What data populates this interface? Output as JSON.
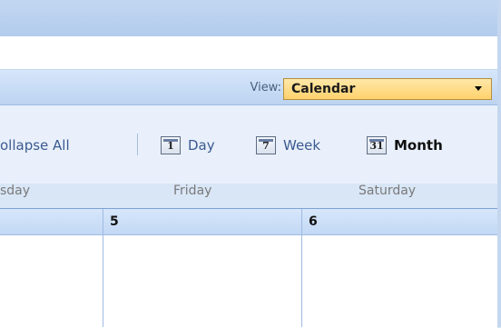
{
  "view_bar": {
    "label": "View:",
    "selected": "Calendar"
  },
  "toolbar": {
    "collapse_label": "ollapse All",
    "day": {
      "icon_text": "1",
      "label": "Day"
    },
    "week": {
      "icon_text": "7",
      "label": "Week"
    },
    "month": {
      "icon_text": "31",
      "label": "Month"
    }
  },
  "calendar": {
    "day_headers": [
      "sday",
      "Friday",
      "Saturday"
    ],
    "dates": [
      "5",
      "6"
    ]
  }
}
